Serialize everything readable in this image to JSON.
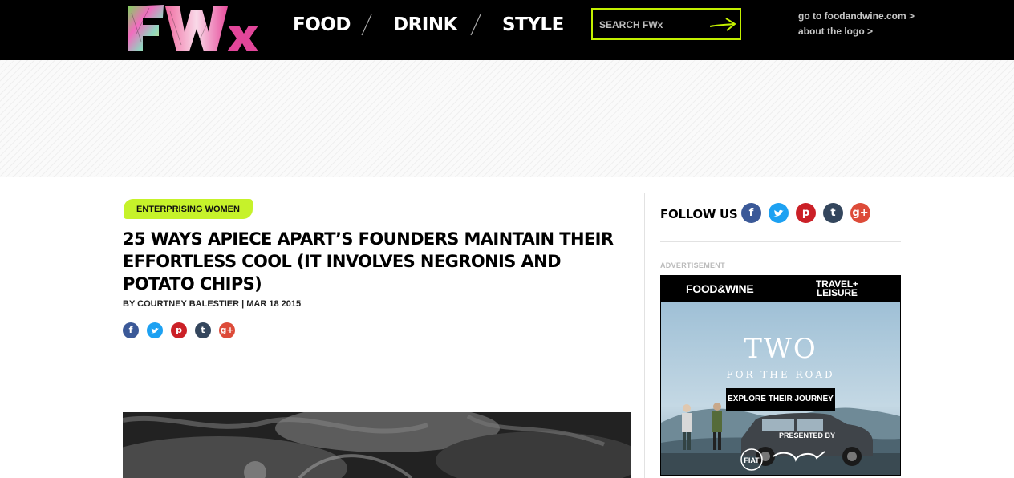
{
  "header": {
    "logo_text": "FWx",
    "nav": [
      "FOOD",
      "DRINK",
      "STYLE"
    ],
    "search_placeholder": "SEARCH FWx",
    "links": [
      "go to foodandwine.com >",
      "about the logo >"
    ]
  },
  "article": {
    "tag": "ENTERPRISING WOMEN",
    "headline": "25 WAYS APIECE APART’S FOUNDERS MAINTAIN THEIR EFFORTLESS COOL (IT INVOLVES NEGRONIS AND POTATO CHIPS)",
    "byline": "BY COURTNEY BALESTIER | MAR 18 2015",
    "share_icons": [
      "facebook-icon",
      "twitter-icon",
      "pinterest-icon",
      "tumblr-icon",
      "google-plus-icon"
    ]
  },
  "sidebar": {
    "follow_label": "FOLLOW US",
    "follow_icons": [
      "facebook-icon",
      "twitter-icon",
      "pinterest-icon",
      "tumblr-icon",
      "google-plus-icon"
    ],
    "ad_label": "ADVERTISEMENT",
    "ad": {
      "brand1": "FOOD&WINE",
      "brand2_line1": "TRAVEL+",
      "brand2_line2": "LEISURE",
      "title": "TWO",
      "subtitle": "FOR THE ROAD",
      "cta": "EXPLORE THEIR JOURNEY",
      "presented": "PRESENTED BY"
    }
  },
  "colors": {
    "accent": "#c6f22a",
    "header_bg": "#000000",
    "facebook": "#3b5998",
    "twitter": "#1da1f2",
    "pinterest": "#cb2027",
    "tumblr": "#34465d",
    "google_plus": "#dd4b39"
  }
}
